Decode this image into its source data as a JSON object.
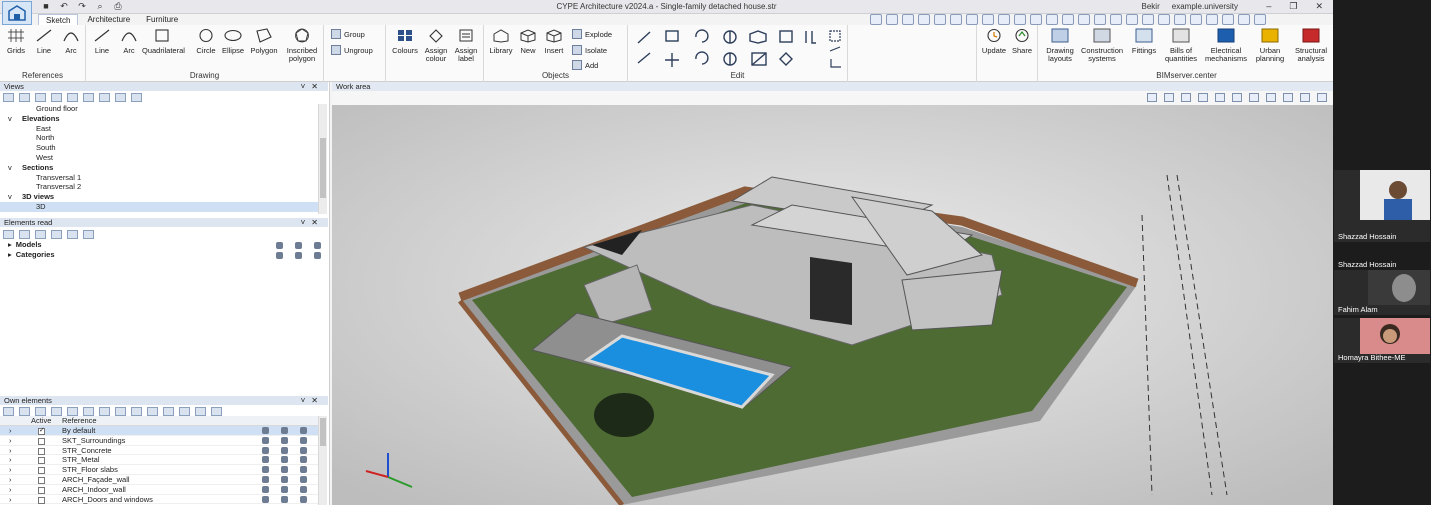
{
  "titlebar": {
    "title": "CYPE Architecture v2024.a - Single-family detached house.str",
    "user_name": "Bekir",
    "org": "example.university"
  },
  "tabs": [
    "Sketch",
    "Architecture",
    "Furniture"
  ],
  "ribbon": {
    "references": {
      "name": "References",
      "buttons": [
        "Grids",
        "Line",
        "Arc"
      ]
    },
    "drawing": {
      "name": "Drawing",
      "buttons": [
        "Line",
        "Arc",
        "Quadrilateral",
        "Circle",
        "Ellipse",
        "Polygon",
        "Inscribed polygon"
      ]
    },
    "group_btns": [
      "Group",
      "Ungroup"
    ],
    "assign_btns": [
      "Colours",
      "Assign colour",
      "Assign label"
    ],
    "objects": {
      "name": "Objects",
      "buttons": [
        "Library",
        "New",
        "Insert"
      ],
      "small": [
        "Explode",
        "Isolate",
        "Add"
      ]
    },
    "edit": {
      "name": "Edit"
    },
    "bim_left": [
      "Update",
      "Share"
    ],
    "bimserver": {
      "name": "BIMserver.center",
      "buttons": [
        "Drawing layouts",
        "Construction systems",
        "Fittings",
        "Bills of quantities",
        "Electrical mechanisms",
        "Urban planning",
        "Structural analysis"
      ]
    }
  },
  "views_panel": {
    "title": "Views",
    "tree": [
      {
        "label": "Ground floor",
        "level": 2,
        "expander": ""
      },
      {
        "label": "Elevations",
        "level": 1,
        "expander": "v",
        "bold": true
      },
      {
        "label": "East",
        "level": 2,
        "expander": ""
      },
      {
        "label": "North",
        "level": 2,
        "expander": ""
      },
      {
        "label": "South",
        "level": 2,
        "expander": ""
      },
      {
        "label": "West",
        "level": 2,
        "expander": ""
      },
      {
        "label": "Sections",
        "level": 1,
        "expander": "v",
        "bold": true
      },
      {
        "label": "Transversal 1",
        "level": 2,
        "expander": ""
      },
      {
        "label": "Transversal 2",
        "level": 2,
        "expander": ""
      },
      {
        "label": "3D views",
        "level": 1,
        "expander": "v",
        "bold": true
      },
      {
        "label": "3D",
        "level": 2,
        "expander": "",
        "selected": true
      }
    ]
  },
  "elements_panel": {
    "title": "Elements read",
    "items": [
      "Models",
      "Categories"
    ]
  },
  "own_panel": {
    "title": "Own elements",
    "columns": [
      "Active",
      "Reference"
    ],
    "rows": [
      {
        "active": true,
        "reference": "By default",
        "selected": true
      },
      {
        "active": false,
        "reference": "SKT_Surroundings"
      },
      {
        "active": false,
        "reference": "STR_Concrete"
      },
      {
        "active": false,
        "reference": "STR_Metal"
      },
      {
        "active": false,
        "reference": "STR_Floor slabs"
      },
      {
        "active": false,
        "reference": "ARCH_Façade_wall"
      },
      {
        "active": false,
        "reference": "ARCH_Indoor_wall"
      },
      {
        "active": false,
        "reference": "ARCH_Doors and windows"
      }
    ]
  },
  "work_area": {
    "title": "Work area"
  },
  "participants": [
    {
      "name": "Shazzad Hossain",
      "caption": "Shazzad Hossain"
    },
    {
      "name": "Fahim Alam"
    },
    {
      "name": "Homayra Bithee-ME"
    }
  ],
  "colors": {
    "accent": "#1e5fa8",
    "panel_header": "#dde5f0",
    "pool": "#1a8fe0",
    "grass": "#4e6b34"
  }
}
